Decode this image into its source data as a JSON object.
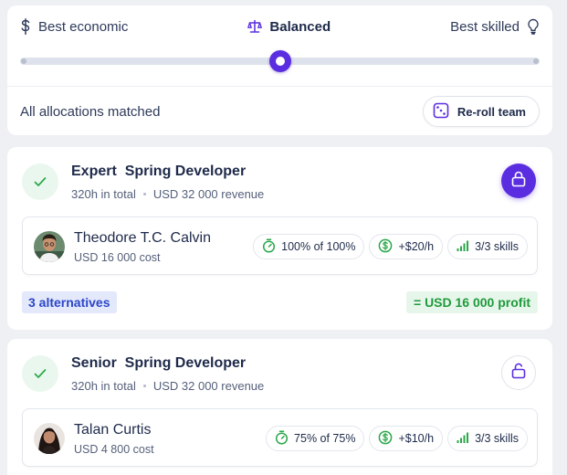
{
  "strategy": {
    "left_label": "Best economic",
    "center_label": "Balanced",
    "right_label": "Best skilled",
    "slider_value_fraction": 0.5
  },
  "status": {
    "text": "All allocations matched",
    "reroll_label": "Re-roll team"
  },
  "roles": [
    {
      "title": "Expert  Spring Developer",
      "hours": "320h in total",
      "revenue": "USD 32 000 revenue",
      "locked": true,
      "member": {
        "name": "Theodore T.C. Calvin",
        "cost": "USD 16 000 cost",
        "allocation": "100% of 100%",
        "rate": "+$20/h",
        "skills": "3/3 skills"
      },
      "alternatives": "3 alternatives",
      "profit": "= USD 16 000 profit"
    },
    {
      "title": "Senior  Spring Developer",
      "hours": "320h in total",
      "revenue": "USD 32 000 revenue",
      "locked": false,
      "member": {
        "name": "Talan Curtis",
        "cost": "USD 4 800 cost",
        "allocation": "75% of 75%",
        "rate": "+$10/h",
        "skills": "3/3 skills"
      }
    }
  ],
  "colors": {
    "accent": "#5a2ee0",
    "success": "#1f9a3c",
    "link": "#2b46c8"
  },
  "icons": [
    "dollar-icon",
    "scale-icon",
    "lightbulb-icon",
    "dice-icon",
    "check-icon",
    "lock-icon",
    "unlock-icon",
    "timer-icon",
    "money-icon",
    "signal-icon"
  ]
}
